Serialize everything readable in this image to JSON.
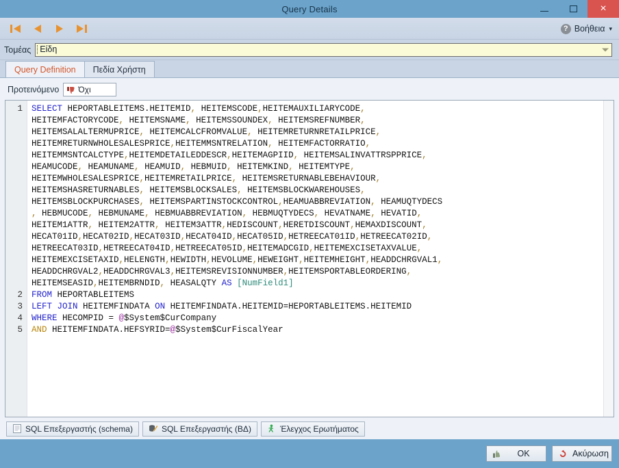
{
  "window": {
    "title": "Query Details",
    "controls": {
      "minimize": "Minimize",
      "maximize": "Maximize",
      "close": "×"
    }
  },
  "commandbar": {
    "nav": [
      {
        "name": "first-record",
        "label": "First"
      },
      {
        "name": "previous-record",
        "label": "Previous"
      },
      {
        "name": "next-record",
        "label": "Next"
      },
      {
        "name": "last-record",
        "label": "Last"
      }
    ],
    "help": {
      "icon": "question-mark-icon",
      "label": "Βοήθεια",
      "caret": "▾"
    }
  },
  "domain": {
    "label": "Τομέας",
    "value": "Είδη"
  },
  "tabs": [
    {
      "label": "Query Definition",
      "active": true
    },
    {
      "label": "Πεδία Χρήστη",
      "active": false
    }
  ],
  "suggested": {
    "label": "Προτεινόμενο",
    "value": "Όχι",
    "icon": "thumbs-down-icon"
  },
  "editor": {
    "line_numbers": [
      "1",
      "2",
      "3",
      "4",
      "5"
    ],
    "lines": [
      "SELECT HEPORTABLEITEMS.HEITEMID, HEITEMSCODE,HEITEMAUXILIARYCODE,",
      "HEITEMFACTORYCODE, HEITEMSNAME, HEITEMSSOUNDEX, HEITEMSREFNUMBER,",
      "HEITEMSALALTERMUPRICE, HEITEMCALCFROMVALUE, HEITEMRETURNRETAILPRICE,",
      "HEITEMRETURNWHOLESALESPRICE,HEITEMMSNTRELATION, HEITEMFACTORRATIO,",
      "HEITEMMSNTCALCTYPE,HEITEMDETAILEDDESCR,HEITEMAGPIID, HEITEMSALINVATTRSPPRICE,",
      "HEAMUCODE, HEAMUNAME, HEAMUID, HEBMUID, HEITEMKIND, HEITEMTYPE,",
      "HEITEMWHOLESALESPRICE,HEITEMRETAILPRICE, HEITEMSRETURNABLEBEHAVIOUR,",
      "HEITEMSHASRETURNABLES, HEITEMSBLOCKSALES, HEITEMSBLOCKWAREHOUSES,",
      "HEITEMSBLOCKPURCHASES, HEITEMSPARTINSTOCKCONTROL,HEAMUABBREVIATION, HEAMUQTYDECS",
      ", HEBMUCODE, HEBMUNAME, HEBMUABBREVIATION, HEBMUQTYDECS, HEVATNAME, HEVATID,",
      "HEITEM1ATTR, HEITEM2ATTR, HEITEM3ATTR,HEDISCOUNT,HERETDISCOUNT,HEMAXDISCOUNT,",
      "HECAT01ID,HECAT02ID,HECAT03ID,HECAT04ID,HECAT05ID,HETREECAT01ID,HETREECAT02ID,",
      "HETREECAT03ID,HETREECAT04ID,HETREECAT05ID,HEITEMADCGID,HEITEMEXCISETAXVALUE,",
      "HEITEMEXCISETAXID,HELENGTH,HEWIDTH,HEVOLUME,HEWEIGHT,HEITEMHEIGHT,HEADDCHRGVAL1,",
      "HEADDCHRGVAL2,HEADDCHRGVAL3,HEITEMSREVISIONNUMBER,HEITEMSPORTABLEORDERING,",
      "HEITEMSEASID,HEITEMBRNDID, HEASALQTY AS [NumField1]",
      "FROM HEPORTABLEITEMS",
      "LEFT JOIN HEITEMFINDATA ON HEITEMFINDATA.HEITEMID=HEPORTABLEITEMS.HEITEMID",
      "WHERE HECOMPID = @$System$CurCompany",
      "AND HEITEMFINDATA.HEFSYRID=@$System$CurFiscalYear"
    ]
  },
  "toolbar": [
    {
      "label": "SQL Επεξεργαστής (schema)",
      "icon": "document-icon",
      "name": "sql-editor-schema-button"
    },
    {
      "label": "SQL Επεξεργαστής (ΒΔ)",
      "icon": "database-query-icon",
      "name": "sql-editor-db-button"
    },
    {
      "label": "Έλεγχος Ερωτήματος",
      "icon": "run-person-icon",
      "name": "check-query-button"
    }
  ],
  "footer": {
    "ok": {
      "label": "OK",
      "icon": "thumbs-up-icon"
    },
    "cancel": {
      "label": "Ακύρωση",
      "icon": "undo-arrow-icon"
    }
  },
  "colors": {
    "titlebar": "#6ba3ca",
    "close": "#d9534f",
    "accent_orange": "#e8922f",
    "active_tab_text": "#d2552b",
    "keyword_blue": "#2222cc",
    "keyword_gold": "#b8860b",
    "alias_teal": "#2e8b7a",
    "field_yellow": "#fbfbd8"
  }
}
